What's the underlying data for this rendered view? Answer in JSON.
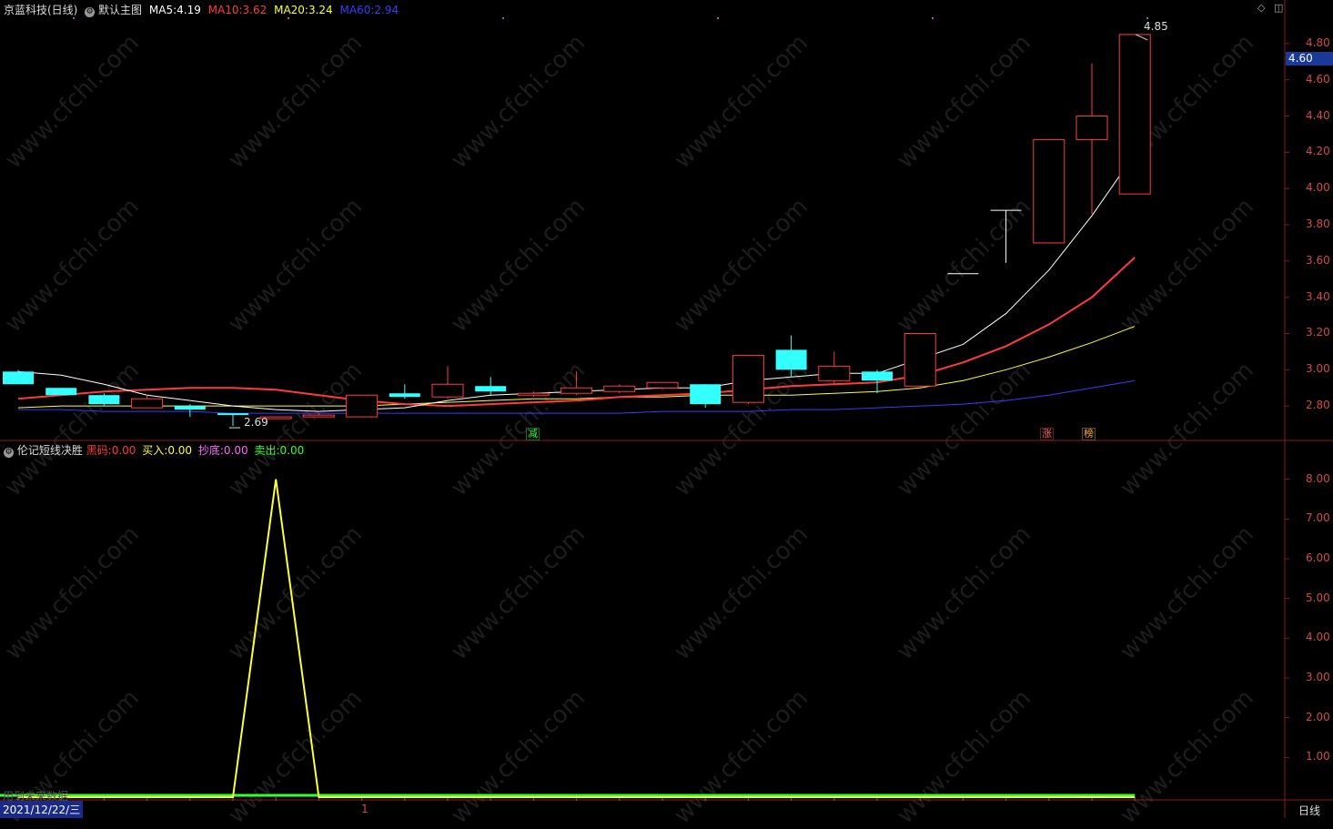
{
  "header": {
    "stock_name": "京蓝科技(日线)",
    "main_chart_label": "默认主图",
    "ma5": {
      "label": "MA5:",
      "value": "4.19",
      "color": "#ffffff"
    },
    "ma10": {
      "label": "MA10:",
      "value": "3.62",
      "color": "#ff3b3b"
    },
    "ma20": {
      "label": "MA20:",
      "value": "3.24",
      "color": "#ffff33"
    },
    "ma60": {
      "label": "MA60:",
      "value": "2.94",
      "color": "#3a3aff"
    }
  },
  "indicator_header": {
    "name": "伦记短线决胜",
    "items": [
      {
        "label": "黑码:",
        "value": "0.00",
        "color": "#ff3b3b"
      },
      {
        "label": "买入:",
        "value": "0.00",
        "color": "#ffff33"
      },
      {
        "label": "抄底:",
        "value": "0.00",
        "color": "#ff66ff"
      },
      {
        "label": "卖出:",
        "value": "0.00",
        "color": "#33ff33"
      }
    ]
  },
  "price_axis": {
    "ticks": [
      "4.80",
      "4.60",
      "4.40",
      "4.20",
      "4.00",
      "3.80",
      "3.60",
      "3.40",
      "3.20",
      "3.00",
      "2.80"
    ],
    "current_price": "4.60"
  },
  "indicator_axis": {
    "ticks": [
      "8.00",
      "7.00",
      "6.00",
      "5.00",
      "4.00",
      "3.00",
      "2.00",
      "1.00"
    ]
  },
  "annotations": {
    "high_label": "4.85",
    "low_label": "2.69",
    "tag_jian": "减",
    "tag_zhang": "涨",
    "tag_bang": "榜"
  },
  "footer": {
    "date": "2021/12/22/三",
    "marker": "1",
    "period": "日线",
    "future_data_note": "用到未来数据"
  },
  "watermark": "www.cfchi.com",
  "chart_data": {
    "type": "candlestick",
    "candles": [
      {
        "o": 2.99,
        "c": 2.92,
        "h": 3.0,
        "l": 2.92
      },
      {
        "o": 2.9,
        "c": 2.86,
        "h": 2.9,
        "l": 2.86
      },
      {
        "o": 2.86,
        "c": 2.81,
        "h": 2.87,
        "l": 2.8
      },
      {
        "o": 2.79,
        "c": 2.84,
        "h": 2.86,
        "l": 2.79
      },
      {
        "o": 2.8,
        "c": 2.78,
        "h": 2.81,
        "l": 2.74
      },
      {
        "o": 2.76,
        "c": 2.75,
        "h": 2.76,
        "l": 2.69
      },
      {
        "o": 2.73,
        "c": 2.74,
        "h": 2.74,
        "l": 2.73
      },
      {
        "o": 2.74,
        "c": 2.75,
        "h": 2.76,
        "l": 2.74
      },
      {
        "o": 2.74,
        "c": 2.86,
        "h": 2.86,
        "l": 2.74
      },
      {
        "o": 2.87,
        "c": 2.85,
        "h": 2.92,
        "l": 2.84
      },
      {
        "o": 2.85,
        "c": 2.92,
        "h": 3.02,
        "l": 2.84
      },
      {
        "o": 2.91,
        "c": 2.88,
        "h": 2.96,
        "l": 2.86
      },
      {
        "o": 2.86,
        "c": 2.87,
        "h": 2.88,
        "l": 2.85
      },
      {
        "o": 2.87,
        "c": 2.9,
        "h": 2.99,
        "l": 2.86
      },
      {
        "o": 2.88,
        "c": 2.91,
        "h": 2.92,
        "l": 2.87
      },
      {
        "o": 2.9,
        "c": 2.93,
        "h": 2.93,
        "l": 2.89
      },
      {
        "o": 2.92,
        "c": 2.81,
        "h": 2.92,
        "l": 2.79
      },
      {
        "o": 2.82,
        "c": 3.08,
        "h": 3.08,
        "l": 2.81
      },
      {
        "o": 3.11,
        "c": 3.0,
        "h": 3.19,
        "l": 2.96
      },
      {
        "o": 2.94,
        "c": 3.02,
        "h": 3.1,
        "l": 2.92
      },
      {
        "o": 2.99,
        "c": 2.94,
        "h": 3.0,
        "l": 2.87
      },
      {
        "o": 2.91,
        "c": 3.2,
        "h": 3.2,
        "l": 2.9
      },
      {
        "o": 3.53,
        "c": 3.53,
        "h": 3.53,
        "l": 3.53
      },
      {
        "o": 3.88,
        "c": 3.88,
        "h": 3.88,
        "l": 3.59
      },
      {
        "o": 3.7,
        "c": 4.27,
        "h": 4.27,
        "l": 3.7
      },
      {
        "o": 4.27,
        "c": 4.4,
        "h": 4.69,
        "l": 3.86
      },
      {
        "o": 3.97,
        "c": 4.85,
        "h": 4.85,
        "l": 3.97
      }
    ],
    "ma5": [
      2.99,
      2.97,
      2.92,
      2.86,
      2.83,
      2.8,
      2.78,
      2.77,
      2.78,
      2.79,
      2.83,
      2.86,
      2.87,
      2.88,
      2.89,
      2.9,
      2.9,
      2.94,
      2.96,
      2.98,
      2.98,
      3.06,
      3.14,
      3.31,
      3.55,
      3.85,
      4.19
    ],
    "ma10": [
      2.84,
      2.86,
      2.88,
      2.89,
      2.9,
      2.9,
      2.89,
      2.86,
      2.83,
      2.81,
      2.8,
      2.81,
      2.82,
      2.83,
      2.85,
      2.86,
      2.87,
      2.89,
      2.91,
      2.92,
      2.93,
      2.97,
      3.04,
      3.13,
      3.25,
      3.4,
      3.62
    ],
    "ma20": [
      2.79,
      2.8,
      2.8,
      2.8,
      2.8,
      2.8,
      2.8,
      2.8,
      2.8,
      2.81,
      2.82,
      2.83,
      2.84,
      2.84,
      2.85,
      2.85,
      2.86,
      2.86,
      2.86,
      2.87,
      2.88,
      2.9,
      2.94,
      3.0,
      3.07,
      3.15,
      3.24
    ],
    "ma60": [
      2.78,
      2.78,
      2.77,
      2.77,
      2.77,
      2.76,
      2.76,
      2.76,
      2.76,
      2.76,
      2.76,
      2.76,
      2.76,
      2.76,
      2.76,
      2.77,
      2.77,
      2.77,
      2.78,
      2.78,
      2.79,
      2.8,
      2.81,
      2.83,
      2.86,
      2.9,
      2.94
    ],
    "indicator_buy": [
      0,
      0,
      0,
      0,
      0,
      0,
      8,
      0,
      0,
      0,
      0,
      0,
      0,
      0,
      0,
      0,
      0,
      0,
      0,
      0,
      0,
      0,
      0,
      0,
      0,
      0,
      0
    ],
    "y_range": [
      2.62,
      4.95
    ],
    "indicator_range": [
      0,
      8.7
    ]
  }
}
